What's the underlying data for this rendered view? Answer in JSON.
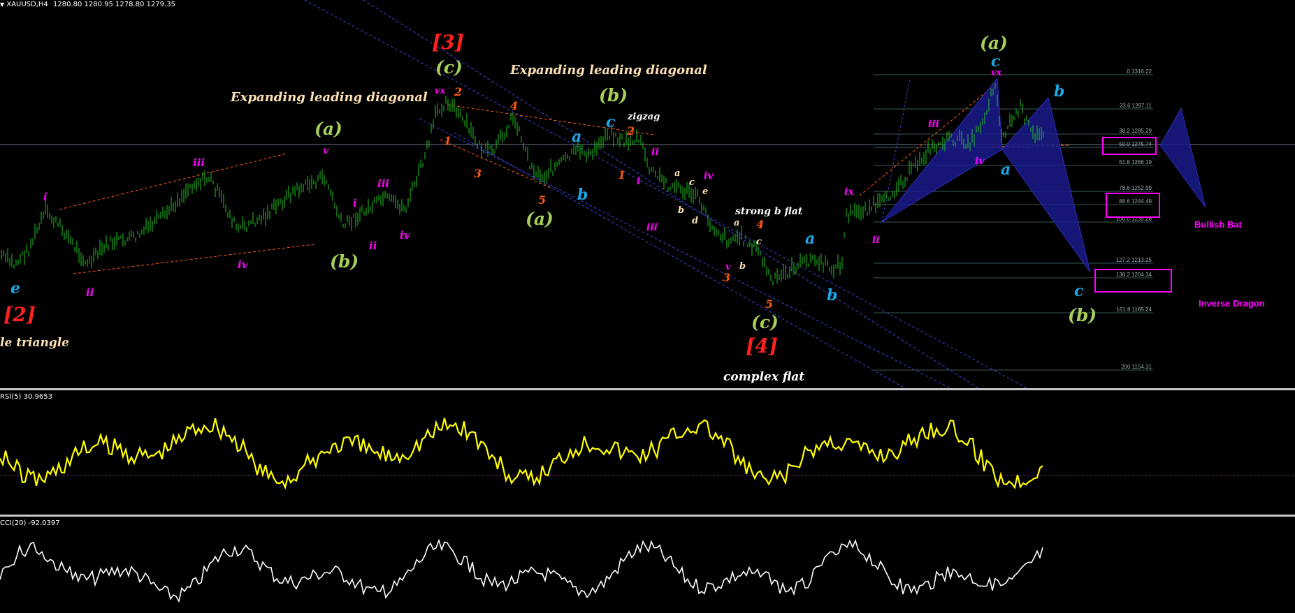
{
  "header": {
    "arrow": "▼",
    "symbol": "XAUUSD,H4",
    "ohlc": "1280.80 1280.95 1278.80 1279.35"
  },
  "rsi": {
    "title": "RSI(5) 30.9653"
  },
  "cci": {
    "title": "CCI(20) -92.0397"
  },
  "patterns": {
    "triangle": "le triangle",
    "diag1": "Expanding leading diagonal",
    "diag2": "Expanding leading diagonal",
    "zigzag": "zigzag",
    "strong_b_flat": "strong b flat",
    "complex_flat": "complex flat",
    "bullish_bat": "Bullish Bat",
    "inverse_dragon": "Inverse Dragon"
  },
  "waves": {
    "major_2": "[2]",
    "major_3": "[3]",
    "major_4": "[4]",
    "e1": "e",
    "i1": "i",
    "ii1": "ii",
    "iii1": "iii",
    "iv1": "iv",
    "v1": "v",
    "a1": "(a)",
    "b1": "(b)",
    "i2": "i",
    "ii2": "ii",
    "iii2": "iii",
    "iv2": "iv",
    "c1": "(c)",
    "vx1": "vx",
    "n1": "1",
    "n2": "2",
    "n3": "3",
    "n4": "4",
    "n5": "5",
    "a2": "(a)",
    "b2": "(b)",
    "a_lc1": "a",
    "b_lc1": "b",
    "c_lc1": "c",
    "n2b": "2",
    "n1b": "1",
    "i3": "i",
    "ii3": "ii",
    "iii3": "iii",
    "w_a": "a",
    "w_b": "b",
    "w_c": "c",
    "w_d": "d",
    "w_e": "e",
    "iv3": "iv",
    "n4b": "4",
    "sa": "a",
    "sb": "b",
    "sc": "c",
    "v3": "v",
    "n3b": "3",
    "n5b": "5",
    "c2": "(c)",
    "a_lc2": "a",
    "b_lc2": "b",
    "ix": "ix",
    "ii4": "ii",
    "iii4": "iii",
    "iv4": "iv",
    "vx2": "vx",
    "a3": "(a)",
    "c_lc2": "c",
    "a_lc3": "a",
    "b_lc3": "b",
    "c_lc3": "c",
    "b3": "(b)"
  },
  "fib_levels": [
    "0 1316.22",
    "23.6 1297.11",
    "38.2 1285.29",
    "50.0 1275.74",
    "61.8 1266.19",
    "78.6 1252.59",
    "88.6 1244.49",
    "100.0 1235.26",
    "127.2 1213.25",
    "138.2 1204.34",
    "161.8 1185.24",
    "200 1154.31"
  ],
  "colors": {
    "candle": "#22c322",
    "rsi_line": "#ffff00",
    "cci_line": "#ffffff",
    "major_label": "#ff2020",
    "green_label": "#a6d05a",
    "blue_label": "#1aa8e8",
    "magenta_label": "#ff00ff",
    "orange_label": "#ff5a10",
    "pattern_text": "#fce1b4",
    "harmonic_fill": "#1a1a8c",
    "fib_line": "#395a5a"
  }
}
